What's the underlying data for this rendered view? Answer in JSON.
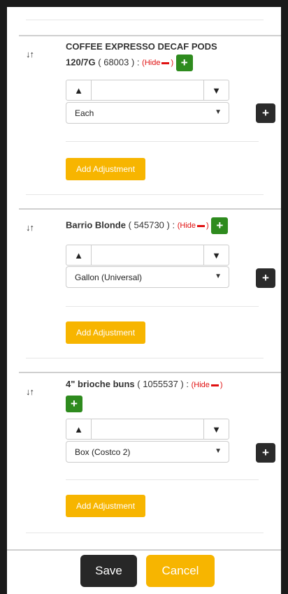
{
  "items": [
    {
      "name_line1": "COFFEE EXPRESSO DECAF PODS",
      "name_line2": "120/7G",
      "code": "( 68003 ) :",
      "hide_label": "(Hide",
      "hide_close": ")",
      "unit": "Each",
      "add_adjustment": "Add Adjustment"
    },
    {
      "name_line1": "Barrio Blonde",
      "code": "( 545730 ) :",
      "hide_label": "(Hide",
      "hide_close": ")",
      "unit": "Gallon (Universal)",
      "add_adjustment": "Add Adjustment"
    },
    {
      "name_line1": "4\" brioche buns",
      "code": "( 1055537 ) :",
      "hide_label": "(Hide",
      "hide_close": ")",
      "unit": "Box (Costco 2)",
      "add_adjustment": "Add Adjustment"
    }
  ],
  "icons": {
    "sort": "sort-icon",
    "up": "chevron-up-icon",
    "down": "chevron-down-icon",
    "plus": "plus-icon"
  },
  "footer": {
    "save_label": "Save",
    "cancel_label": "Cancel"
  },
  "colors": {
    "green": "#2e8b1e",
    "yellow": "#f7b500",
    "dark": "#2b2b2b",
    "hide_red": "#e01010"
  }
}
